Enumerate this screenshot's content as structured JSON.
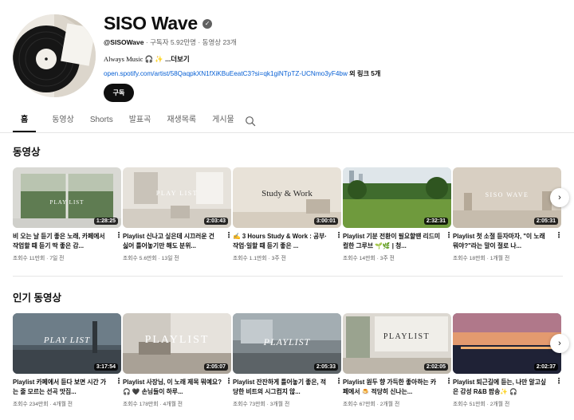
{
  "channel": {
    "name": "SISO Wave",
    "handle": "@SISOWave",
    "stats": "· 구독자 5.92만명 · 동영상 23개",
    "description": "Always Music 🎧 ✨",
    "more_label": " ...더보기",
    "link_url": "open.spotify.com/artist/58QaqpkXN1fXiKBuEeatC3?si=qk1giNTpTZ-UCNmo3yF4bw",
    "link_extra": " 외 링크 5개",
    "subscribe_label": "구독"
  },
  "tabs": [
    {
      "label": "홈",
      "active": true
    },
    {
      "label": "동영상"
    },
    {
      "label": "Shorts"
    },
    {
      "label": "발표곡"
    },
    {
      "label": "재생목록"
    },
    {
      "label": "게시물"
    }
  ],
  "sections": [
    {
      "title": "동영상",
      "videos": [
        {
          "title": "비 오는 날 듣기 좋은 노래, 카페에서 작업할 때 듣기 딱 좋은 감...",
          "views": "조회수 11만회",
          "age": "7일 전",
          "duration": "1:28:25",
          "thumb_text": "PLAY LIST"
        },
        {
          "title": "Playlist 신나고 싶은데 시끄러운 건 싫어 틀어놓기만 해도 분위...",
          "views": "조회수 5.6만회",
          "age": "13일 전",
          "duration": "2:03:43",
          "thumb_text": "PLAY LIST"
        },
        {
          "title": "✍️ 3 Hours Study & Work : 공부·작업·일할 때 듣기 좋은 ...",
          "views": "조회수 1.1만회",
          "age": "3주 전",
          "duration": "3:00:01",
          "thumb_text": "Study & Work"
        },
        {
          "title": "Playlist 기분 전환이 필요할땐 리드미컬한 그루브 🌱🌿 | 청...",
          "views": "조회수 14만회",
          "age": "3주 전",
          "duration": "2:32:31",
          "thumb_text": ""
        },
        {
          "title": "Playlist 첫 소절 듣자마자, \"이 노래 뭐야?\"라는 말이 절로 나...",
          "views": "조회수 18만회",
          "age": "1개월 전",
          "duration": "2:05:31",
          "thumb_text": "SISO WAVE"
        }
      ]
    },
    {
      "title": "인기 동영상",
      "videos": [
        {
          "title": "Playlist 카페에서 듣다 보면 시간 가는 줄 모르는 선곡 맛집...",
          "views": "조회수 234만회",
          "age": "4개월 전",
          "duration": "3:17:54",
          "thumb_text": "PLAY LIST"
        },
        {
          "title": "Playlist 사장님, 이 노래 제목 뭐예요? 🎧 🖤 손님들이 하루...",
          "views": "조회수 178만회",
          "age": "4개월 전",
          "duration": "2:05:07",
          "thumb_text": "PLAYLIST"
        },
        {
          "title": "Playlist 잔잔하게 틀어놓기 좋은, 적당한 비트의 시그컴지 않...",
          "views": "조회수 73만회",
          "age": "3개월 전",
          "duration": "2:05:33",
          "thumb_text": "PLAYLIST"
        },
        {
          "title": "Playlist 원두 향 가득한 좋아하는 카페에서 🍮 적당히 신나는...",
          "views": "조회수 67만회",
          "age": "2개월 전",
          "duration": "2:02:05",
          "thumb_text": "PLAYLIST"
        },
        {
          "title": "Playlist 퇴근길에 듣는, 나만 알고싶은 감성 R&B 팝송✨ 🎧",
          "views": "조회수 51만회",
          "age": "2개월 전",
          "duration": "2:02:37",
          "thumb_text": ""
        }
      ]
    }
  ],
  "icons": {
    "verified": "verified-check-icon",
    "search": "search-icon",
    "more": "more-vert-icon",
    "next": "chevron-right-icon"
  }
}
